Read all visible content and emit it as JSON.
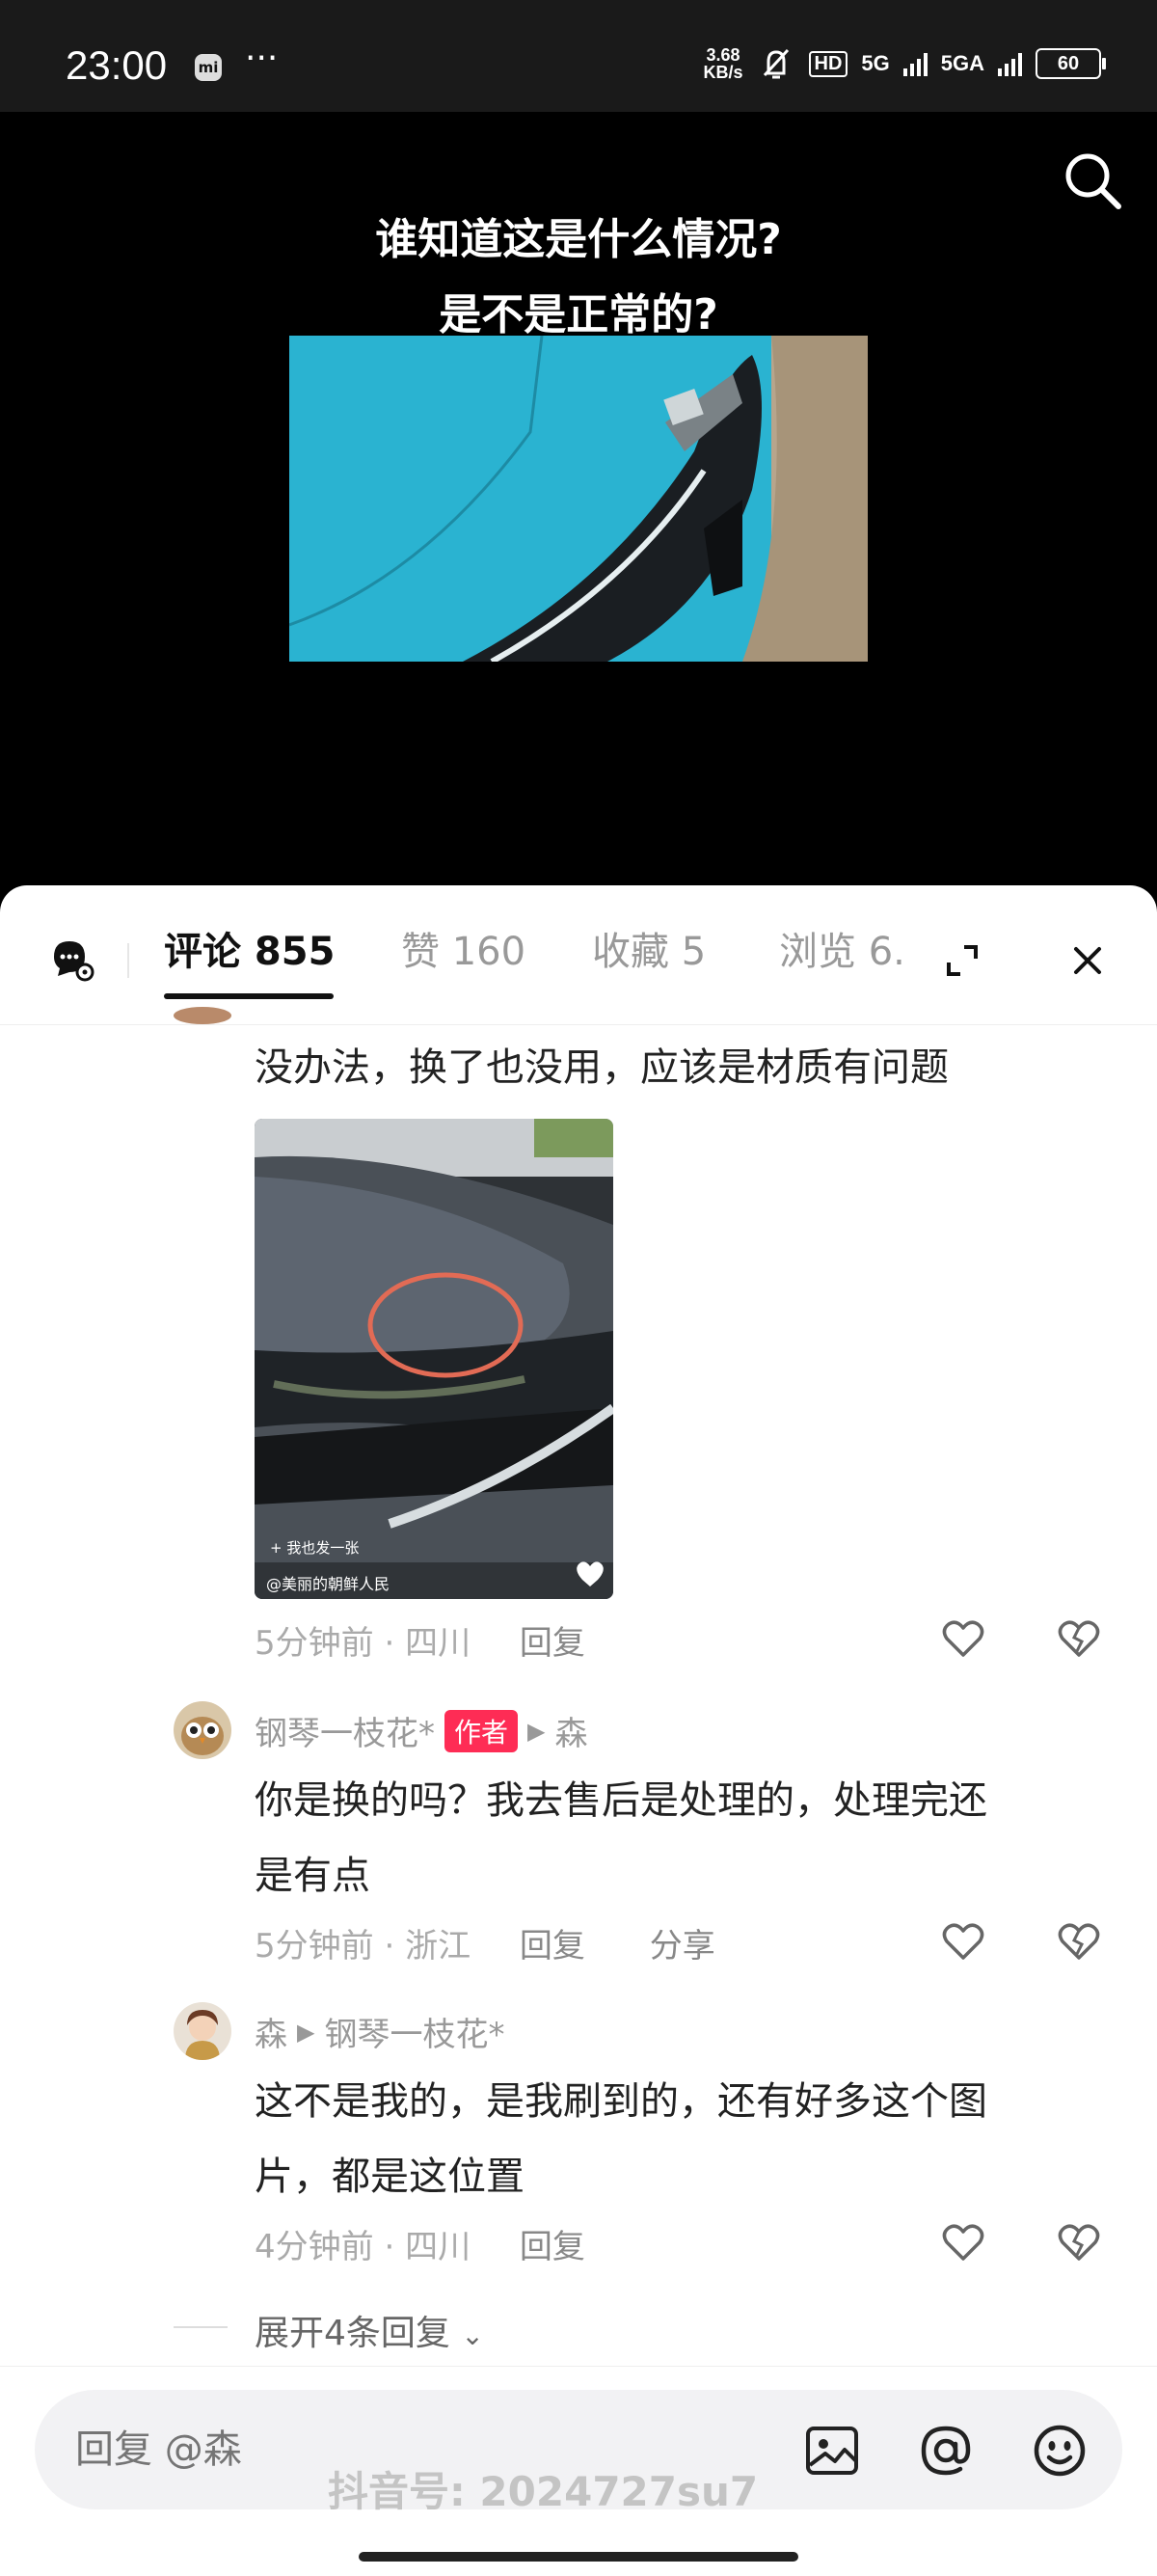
{
  "status_bar": {
    "time": "23:00",
    "mi_label": "mi",
    "more": "···",
    "speed_value": "3.68",
    "speed_unit": "KB/s",
    "hd_label": "HD",
    "network1": "5G",
    "network2": "5GA",
    "battery": "60"
  },
  "video": {
    "caption_line1": "谁知道这是什么情况?",
    "caption_line2": "是不是正常的?"
  },
  "tabs": {
    "comments": "评论 855",
    "likes": "赞 160",
    "favorites": "收藏 5",
    "views": "浏览 6."
  },
  "comments": [
    {
      "text": "没办法，换了也没用，应该是材质有问题",
      "image_caption": "@美丽的朝鲜人民",
      "image_tag": "+ 我也发一张",
      "time": "5分钟前",
      "location": "四川",
      "reply_label": "回复"
    },
    {
      "user": "钢琴一枝花*",
      "badge": "作者",
      "reply_to": "森",
      "text_line1": "你是换的吗？我去售后是处理的，处理完还",
      "text_line2": "是有点",
      "time": "5分钟前",
      "location": "浙江",
      "reply_label": "回复",
      "share_label": "分享"
    },
    {
      "user": "森",
      "reply_to": "钢琴一枝花*",
      "text_line1": "这不是我的，是我刷到的，还有好多这个图",
      "text_line2": "片，都是这位置",
      "time": "4分钟前",
      "location": "四川",
      "reply_label": "回复"
    }
  ],
  "expand_replies": "展开4条回复",
  "input": {
    "placeholder": "回复 @森"
  },
  "watermark": "抖音号: 2024727su7",
  "colors": {
    "accent": "#fe2c55",
    "car_blue": "#2ab3d1"
  }
}
